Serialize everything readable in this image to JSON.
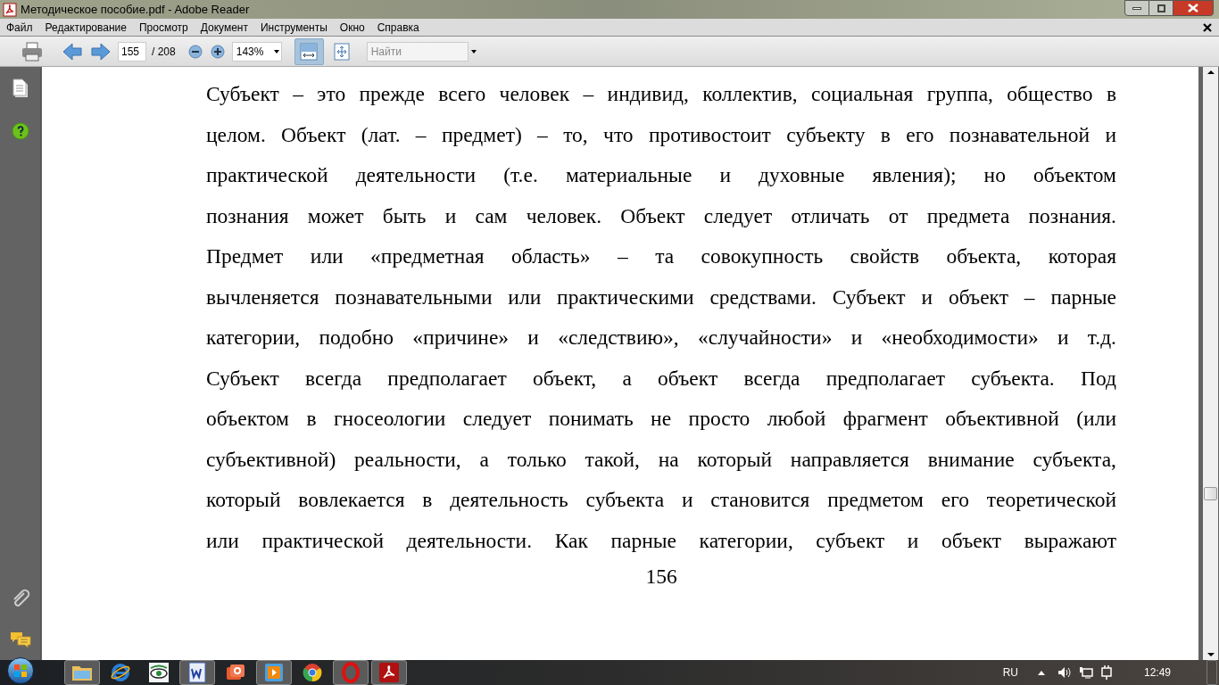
{
  "window": {
    "title": "Методическое пособие.pdf - Adobe Reader"
  },
  "menu": [
    "Файл",
    "Редактирование",
    "Просмотр",
    "Документ",
    "Инструменты",
    "Окно",
    "Справка"
  ],
  "toolbar": {
    "page": "155",
    "page_total": "/ 208",
    "zoom": "143%",
    "search": {
      "placeholder": "Найти"
    },
    "fit_width_selected": true
  },
  "document": {
    "lines": [
      "Субъект – это прежде всего человек – индивид, коллектив, социальная группа, общество в",
      "целом. Объект (лат. – предмет) – то, что противостоит субъекту в его познавательной и",
      "практической деятельности (т.е. материальные и духовные явления); но объектом",
      "познания может быть и сам человек. Объект следует отличать от предмета познания.",
      "Предмет или «предметная область» – та совокупность свойств объекта, которая",
      "вычленяется познавательными или практическими средствами. Субъект и объект – парные",
      "категории, подобно «причине» и «следствию», «случайности» и «необходимости» и т.д.",
      "Субъект всегда предполагает объект, а объект всегда предполагает субъекта. Под",
      "объектом в гносеологии следует понимать не просто любой фрагмент объективной (или",
      "субъективной) реальности, а только такой, на который направляется внимание субъекта,",
      "который вовлекается в деятельность субъекта и становится предметом его теоретической",
      "или практической деятельности. Как парные категории, субъект и объект выражают"
    ],
    "page_number": "156"
  },
  "taskbar": {
    "apps": [
      {
        "kind": "folder",
        "active": true
      },
      {
        "kind": "ie",
        "active": false
      },
      {
        "kind": "eye",
        "active": false
      },
      {
        "kind": "word",
        "active": true
      },
      {
        "kind": "camera",
        "active": false
      },
      {
        "kind": "player",
        "active": true
      },
      {
        "kind": "chrome",
        "active": false
      },
      {
        "kind": "opera",
        "active": true
      },
      {
        "kind": "pdf",
        "active": true
      }
    ],
    "language": "RU",
    "clock": "12:49"
  }
}
